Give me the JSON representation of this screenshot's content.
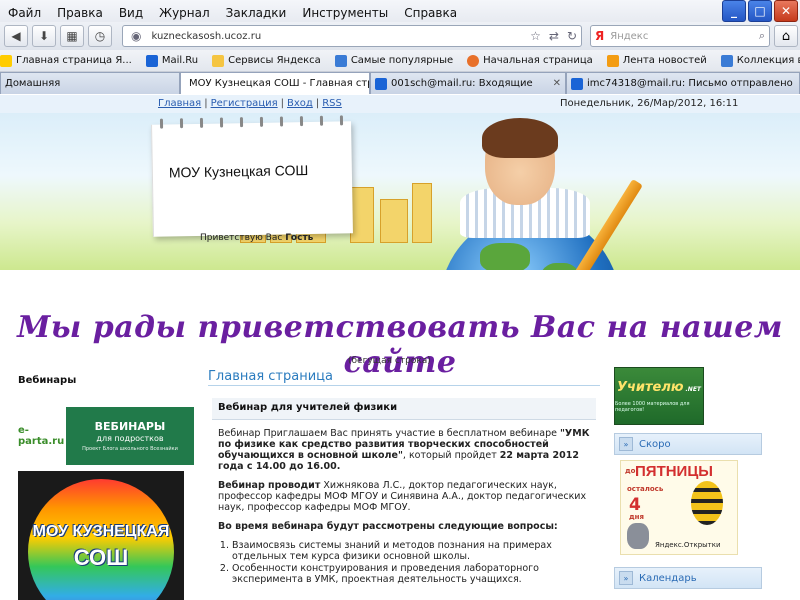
{
  "browser": {
    "menu": [
      "Файл",
      "Правка",
      "Вид",
      "Журнал",
      "Закладки",
      "Инструменты",
      "Справка"
    ],
    "window_buttons": [
      "_",
      "□",
      "✕"
    ],
    "url": "kuzneckasosh.ucoz.ru",
    "search_placeholder": "Яндекс",
    "search_brand": "Я",
    "bookmarks": [
      {
        "label": "Главная страница Я...",
        "color": "#ffcc00"
      },
      {
        "label": "Mail.Ru",
        "color": "#1a64d6"
      },
      {
        "label": "Сервисы Яндекса",
        "color": "#f5c542"
      },
      {
        "label": "Самые популярные",
        "color": "#3a7bd5"
      },
      {
        "label": "Начальная страница",
        "color": "#e8702a"
      },
      {
        "label": "Лента новостей",
        "color": "#f39c12"
      },
      {
        "label": "Коллекция веб-фраг...",
        "color": "#3a7bd5"
      }
    ],
    "tabs": [
      {
        "label": "Домашняя",
        "color": "#4c8bd6"
      },
      {
        "label": "МОУ Кузнецкая СОШ - Главная стра...",
        "color": "#e8702a"
      },
      {
        "label": "001sch@mail.ru: Входящие",
        "color": "#1a64d6"
      },
      {
        "label": "imc74318@mail.ru: Письмо отправлено",
        "color": "#1a64d6"
      }
    ]
  },
  "site": {
    "top_links": [
      "Главная",
      "Регистрация",
      "Вход",
      "RSS"
    ],
    "date": "Понедельник, 26/Мар/2012, 16:11",
    "school_name": "МОУ Кузнецкая СОШ",
    "greeting_prefix": "Приветствую Вас",
    "greeting_user": "Гость",
    "big_title": "Мы рады приветствовать Вас на нашем сайте",
    "ticker_label": "(бегущая строка)",
    "left": {
      "webinars_heading": "Вебинары",
      "eparta_logo": "e-parta.ru",
      "eparta_title": "ВЕБИНАРЫ",
      "eparta_subtitle": "для подростков",
      "eparta_caption": "Проект Блога школьного Всезнайки",
      "badge_line1": "МОУ КУЗНЕЦКАЯ",
      "badge_line2": "СОШ"
    },
    "main": {
      "page_title": "Главная страница",
      "news_heading": "Вебинар для учителей физики",
      "p1_start": "Вебинар Приглашаем Вас принять участие в бесплатном вебинаре ",
      "p1_bold": "\"УМК по физике как средство развития творческих способностей обучающихся в основной школе\"",
      "p1_mid": ", который пройдет ",
      "p1_date": "22 марта 2012 года с  14.00 до 16.00.",
      "p2_bold": "Вебинар проводит",
      "p2_rest": " Хижнякова Л.С., доктор педагогических наук, профессор кафедры МОФ МГОУ  и  Синявина А.А., доктор педагогических наук, профессор кафедры МОФ МГОУ.",
      "p3_bold": "Во время вебинара будут рассмотрены следующие вопросы:",
      "list": [
        "Взаимосвязь системы знаний и методов познания на примерах отдельных тем курса физики основной школы.",
        "Особенности конструирования и проведения лабораторного эксперимента в УМК, проектная деятельность учащихся."
      ]
    },
    "right": {
      "uchitelyu_title": "Учителю",
      "uchitelyu_net": ".NET",
      "uchitelyu_caption": "Более 1000 материалов для педагогов!",
      "skoro_heading": "Скоро",
      "card_do": "до",
      "card_day": "ПЯТНИЦЫ",
      "card_ostalos": "осталось",
      "card_num": "4",
      "card_dnya": "дня",
      "card_brand": "Яндекс.Открытки",
      "calendar_heading": "Календарь"
    }
  }
}
